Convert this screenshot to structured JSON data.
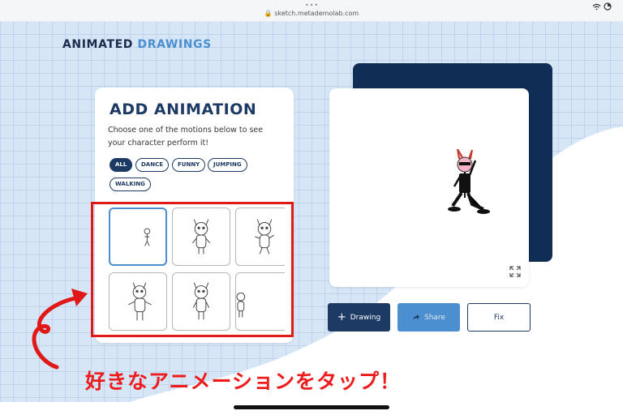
{
  "browser": {
    "url": "sketch.metademolab.com",
    "dots": "•••",
    "status_icons": "wifi-icon battery-icon"
  },
  "brand": {
    "part1": "ANIMATED",
    "part2": "DRAWINGS"
  },
  "card": {
    "title": "ADD ANIMATION",
    "description": "Choose one of the motions below to see your character perform it!",
    "filters": [
      "ALL",
      "DANCE",
      "FUNNY",
      "JUMPING",
      "WALKING"
    ],
    "active_filter": "ALL"
  },
  "buttons": {
    "drawing": "Drawing",
    "share": "Share",
    "fix": "Fix"
  },
  "caption": "好きなアニメーションをタップ！",
  "colors": {
    "navy": "#0f2d55",
    "accent": "#4b8fd0",
    "highlight_red": "#e01818"
  }
}
